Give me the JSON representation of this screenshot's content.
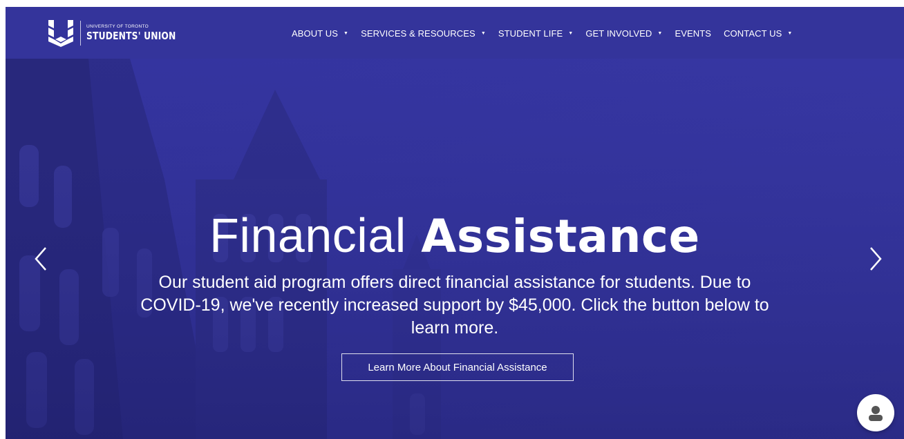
{
  "header": {
    "logo": {
      "small_text": "UNIVERSITY OF TORONTO",
      "big_text": "STUDENTS' UNION"
    },
    "nav": [
      {
        "label": "ABOUT US",
        "has_dropdown": true
      },
      {
        "label": "SERVICES & RESOURCES",
        "has_dropdown": true
      },
      {
        "label": "STUDENT LIFE",
        "has_dropdown": true
      },
      {
        "label": "GET INVOLVED",
        "has_dropdown": true
      },
      {
        "label": "EVENTS",
        "has_dropdown": false
      },
      {
        "label": "CONTACT US",
        "has_dropdown": true
      }
    ],
    "caret": "▼"
  },
  "hero": {
    "title_light": "Financial",
    "title_bold": "Assistance",
    "subtitle": "Our student aid program offers direct financial assistance for students. Due to COVID-19, we've recently increased support by $45,000. Click the button below to learn more.",
    "button_label": "Learn More About Financial Assistance",
    "prev_icon": "chevron-left-icon",
    "next_icon": "chevron-right-icon"
  },
  "chat": {
    "icon": "user-icon"
  },
  "colors": {
    "brand_blue": "#34349b",
    "overlay_blue": "#3a3aa0",
    "text": "#ffffff"
  }
}
